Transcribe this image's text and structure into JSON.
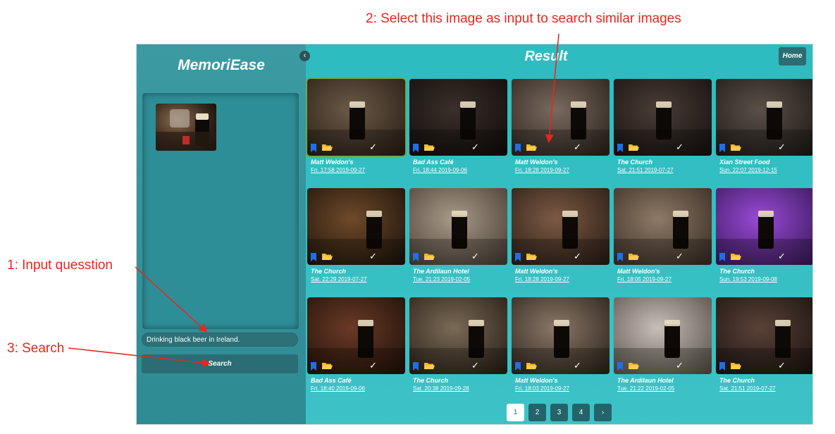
{
  "annotations": {
    "step1": "1: Input quesstion",
    "step2": "2: Select  this image as input to search similar images",
    "step3": "3: Search"
  },
  "colors": {
    "annotation_red": "#e8261c",
    "sidebar_teal": "#3b9aa2",
    "main_teal": "#2dbcc0",
    "button_dark": "#2a6d74",
    "bookmark_blue": "#1e6fe8",
    "folder_yellow": "#f5b82e",
    "selected_border": "#6aa84f"
  },
  "sidebar": {
    "brand": "MemoriEase",
    "collapse_icon": "chevron-left-icon",
    "question_value": "Drinking black beer in Ireland.",
    "search_label": "Search"
  },
  "header": {
    "title": "Result",
    "home_label": "Home"
  },
  "results": [
    {
      "title": "Matt Weldon's",
      "date": "Fri. 17:58 2019-09-27"
    },
    {
      "title": "Bad Ass Café",
      "date": "Fri. 18:44 2019-09-06"
    },
    {
      "title": "Matt Weldon's",
      "date": "Fri. 18:28 2019-09-27"
    },
    {
      "title": "The Church",
      "date": "Sat. 21:51 2019-07-27"
    },
    {
      "title": "Xian Street Food",
      "date": "Sun. 22:07 2019-12-15"
    },
    {
      "title": "The Church",
      "date": "Sat. 22:29 2019-07-27"
    },
    {
      "title": "The Ardilaun Hotel",
      "date": "Tue. 21:23 2019-02-05"
    },
    {
      "title": "Matt Weldon's",
      "date": "Fri. 18:28 2019-09-27"
    },
    {
      "title": "Matt Weldon's",
      "date": "Fri. 18:05 2019-09-27"
    },
    {
      "title": "The Church",
      "date": "Sun. 19:53 2019-09-08"
    },
    {
      "title": "Bad Ass Café",
      "date": "Fri. 18:40 2019-09-06"
    },
    {
      "title": "The Church",
      "date": "Sat. 20:38 2019-09-28"
    },
    {
      "title": "Matt Weldon's",
      "date": "Fri. 18:03 2019-09-27"
    },
    {
      "title": "The Ardilaun Hotel",
      "date": "Tue. 21:22 2019-02-05"
    },
    {
      "title": "The Church",
      "date": "Sat. 21:51 2019-07-27"
    }
  ],
  "card_icons": [
    "bookmark-icon",
    "folder-icon",
    "checkmark-icon"
  ],
  "pagination": {
    "pages": [
      "1",
      "2",
      "3",
      "4"
    ],
    "current": "1",
    "next_icon": "chevron-right-icon"
  }
}
